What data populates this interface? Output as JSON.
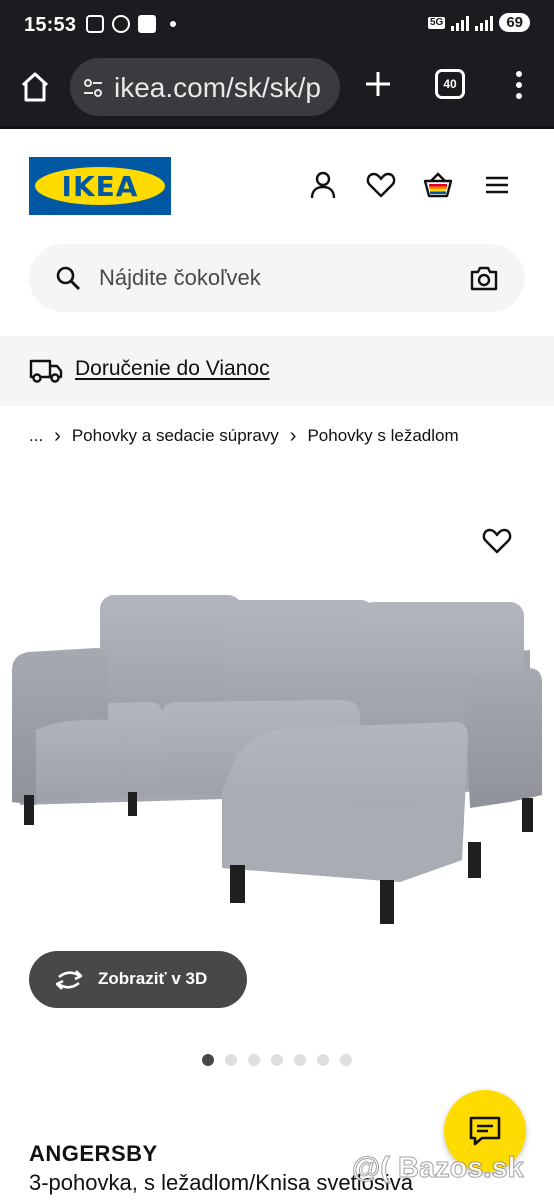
{
  "status_bar": {
    "time": "15:53",
    "network": "5G",
    "battery": "69"
  },
  "browser": {
    "url": "ikea.com/sk/sk/p",
    "tab_count": "40"
  },
  "header": {
    "logo_text": "IKEA",
    "brand_blue": "#0058a3",
    "brand_yellow": "#ffdb00",
    "icons": [
      "user-icon",
      "heart-icon",
      "basket-icon",
      "hamburger-menu-icon"
    ]
  },
  "search": {
    "placeholder": "Nájdite čokoľvek"
  },
  "delivery": {
    "label": "Doručenie do Vianoc"
  },
  "breadcrumb": {
    "items": [
      "...",
      "Pohovky a sedacie súpravy",
      "Pohovky s ležadlom"
    ]
  },
  "gallery": {
    "view_3d_label": "Zobraziť v 3D",
    "total_images": 7,
    "active_index": 0
  },
  "product": {
    "name": "ANGERSBY",
    "description": "3-pohovka, s ležadlom/Knisa svetlosivá"
  },
  "watermark": "@( Bazos.sk"
}
